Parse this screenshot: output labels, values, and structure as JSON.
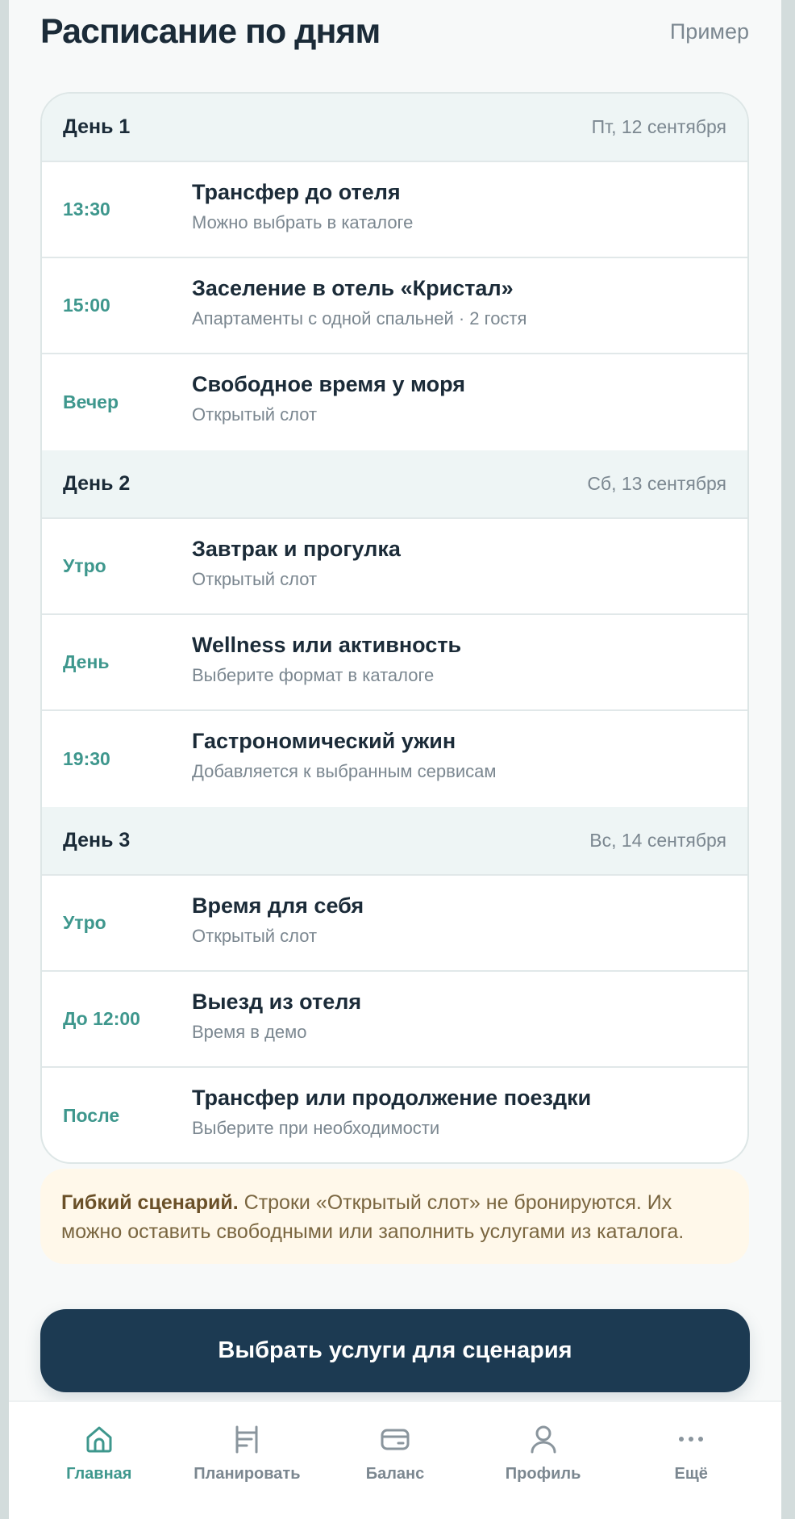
{
  "header": {
    "title": "Расписание по дням",
    "example_label": "Пример"
  },
  "days": [
    {
      "title": "День 1",
      "date": "Пт, 12 сентября",
      "slots": [
        {
          "time": "13:30",
          "title": "Трансфер до отеля",
          "subtitle": "Можно выбрать в каталоге"
        },
        {
          "time": "15:00",
          "title": "Заселение в отель «Кристал»",
          "subtitle": "Апартаменты с одной спальней · 2 гостя"
        },
        {
          "time": "Вечер",
          "title": "Свободное время у моря",
          "subtitle": "Открытый слот"
        }
      ]
    },
    {
      "title": "День 2",
      "date": "Сб, 13 сентября",
      "slots": [
        {
          "time": "Утро",
          "title": "Завтрак и прогулка",
          "subtitle": "Открытый слот"
        },
        {
          "time": "День",
          "title": "Wellness или активность",
          "subtitle": "Выберите формат в каталоге"
        },
        {
          "time": "19:30",
          "title": "Гастрономический ужин",
          "subtitle": "Добавляется к выбранным сервисам"
        }
      ]
    },
    {
      "title": "День 3",
      "date": "Вс, 14 сентября",
      "slots": [
        {
          "time": "Утро",
          "title": "Время для себя",
          "subtitle": "Открытый слот"
        },
        {
          "time": "До 12:00",
          "title": "Выезд из отеля",
          "subtitle": "Время в демо"
        },
        {
          "time": "После",
          "title": "Трансфер или продолжение поездки",
          "subtitle": "Выберите при необходимости"
        }
      ]
    }
  ],
  "notice": {
    "bold": "Гибкий сценарий.",
    "text": " Строки «Открытый слот» не бронируются. Их можно оставить свободными или заполнить услугами из каталога."
  },
  "cta": {
    "label": "Выбрать услуги для сценария"
  },
  "tabbar": {
    "items": [
      {
        "label": "Главная",
        "icon": "home-icon",
        "active": true
      },
      {
        "label": "Планировать",
        "icon": "planner-icon",
        "active": false
      },
      {
        "label": "Баланс",
        "icon": "wallet-icon",
        "active": false
      },
      {
        "label": "Профиль",
        "icon": "user-icon",
        "active": false
      },
      {
        "label": "Ещё",
        "icon": "more-icon",
        "active": false
      }
    ]
  },
  "colors": {
    "accent": "#3e978d",
    "primary_dark": "#1c3a52",
    "day_header_bg": "#eef5f5",
    "notice_bg": "#fff8ea"
  }
}
